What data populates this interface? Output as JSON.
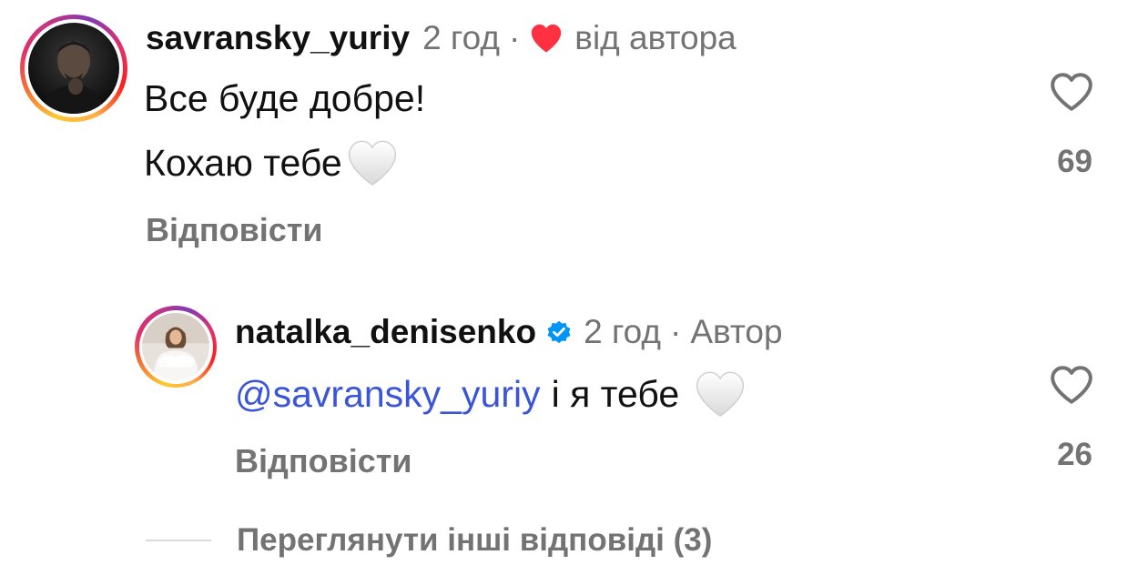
{
  "comments": [
    {
      "username": "savransky_yuriy",
      "time": "2 год",
      "separator": "·",
      "liked_by_author": "від автора",
      "lines": [
        "Все буде добре!",
        "Кохаю тебе"
      ],
      "reply_label": "Відповісти",
      "like_count": "69"
    },
    {
      "username": "natalka_denisenko",
      "verified": true,
      "time": "2 год",
      "separator": "·",
      "author_badge": "Автор",
      "mention": "@savransky_yuriy",
      "text": "і я тебе",
      "reply_label": "Відповісти",
      "like_count": "26"
    }
  ],
  "view_more_label": "Переглянути інші відповіді (3)",
  "colors": {
    "muted": "#737373",
    "mention": "#3b55d9",
    "heart_red": "#ff3040",
    "verified_blue": "#0095f6"
  },
  "icons": {
    "author_like": "red-heart-icon",
    "emoji": "white-heart-emoji",
    "like": "heart-outline-icon",
    "verified": "verified-badge-icon"
  }
}
